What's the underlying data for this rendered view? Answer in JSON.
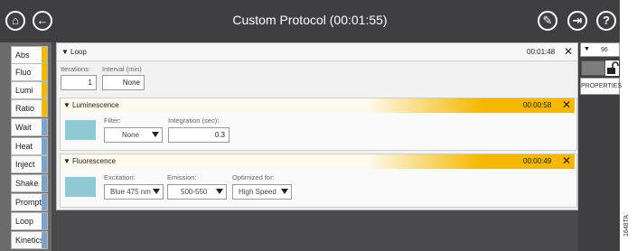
{
  "app": {
    "title": "Custom Protocol (00:01:55)"
  },
  "toolbar": {
    "home_icon": "home-icon",
    "back_icon": "back-arrow-icon",
    "edit_icon": "pencil-icon",
    "exit_icon": "exit-icon",
    "help_label": "?"
  },
  "sidebar": {
    "items": [
      {
        "label": "Abs",
        "color": "#f5b800"
      },
      {
        "label": "Fluo",
        "color": "#f5b800"
      },
      {
        "label": "Lumi",
        "color": "#f5b800"
      },
      {
        "label": "Ratio",
        "color": "#f5b800"
      },
      {
        "label": "Wait",
        "color": "#7fa3c7"
      },
      {
        "label": "Heat",
        "color": "#7fa3c7"
      },
      {
        "label": "Inject",
        "color": "#7fa3c7"
      },
      {
        "label": "Shake",
        "color": "#7fa3c7"
      },
      {
        "label": "Prompt",
        "color": "#7fa3c7"
      },
      {
        "label": "Loop",
        "color": "#7fa3c7"
      },
      {
        "label": "Kinetics",
        "color": "#7fa3c7"
      }
    ]
  },
  "loop": {
    "title": "Loop",
    "time": "00:01:48",
    "iterations_label": "Iterations:",
    "iterations_value": "1",
    "interval_label": "Interval (min)",
    "interval_value": "None"
  },
  "luminescence": {
    "title": "Luminescence",
    "time": "00:00:58",
    "filter_label": "Filter:",
    "filter_value": "None",
    "integration_label": "Integration (sec):",
    "integration_value": "0.3"
  },
  "fluorescence": {
    "title": "Fluorescence",
    "time": "00:00:49",
    "excitation_label": "Excitation:",
    "excitation_value": "Blue 475 nm",
    "emission_label": "Emission:",
    "emission_value": "500-550",
    "optimized_label": "Optimized for:",
    "optimized_value": "High Speed"
  },
  "right_panel": {
    "plate_value": "96",
    "properties_label": "PROPERTIES"
  },
  "figure_label": "1648TA",
  "colors": {
    "accent": "#f5b800",
    "swatch": "#8fc9d3",
    "topbar": "#3f3f41"
  }
}
